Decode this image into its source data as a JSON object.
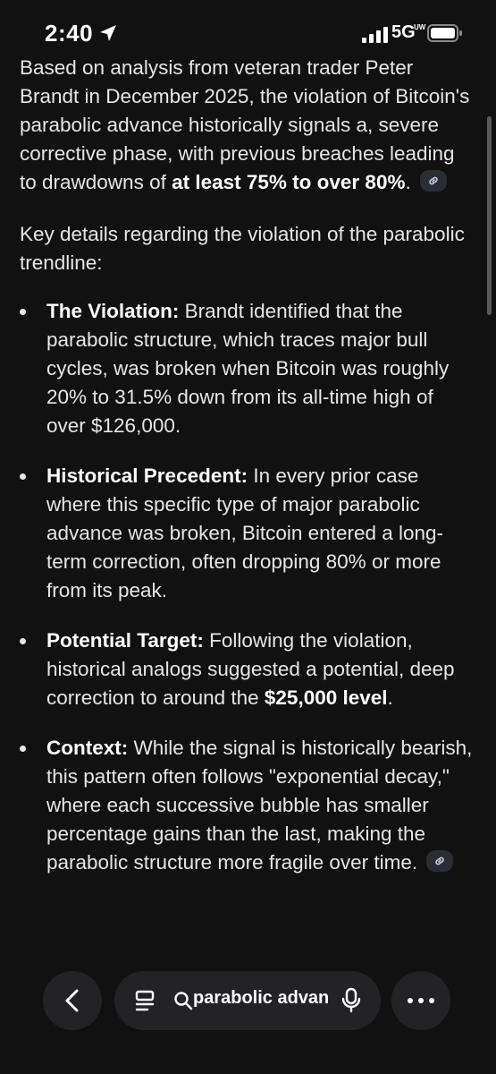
{
  "status": {
    "time": "2:40",
    "network": "5G",
    "network_sub": "UW"
  },
  "article": {
    "intro_text": "Based on analysis from veteran trader Peter Brandt in December 2025, the violation of Bitcoin's parabolic advance historically signals a, severe corrective phase, with previous breaches leading to drawdowns of ",
    "intro_bold": "at least 75% to over 80%",
    "intro_end": ".",
    "key_details": "Key details regarding the violation of the parabolic trendline:",
    "bullets": [
      {
        "title": "The Violation:",
        "text": " Brandt identified that the parabolic structure, which traces major bull cycles, was broken when Bitcoin was roughly 20% to 31.5% down from its all-time high of over $126,000."
      },
      {
        "title": "Historical Precedent:",
        "text": " In every prior case where this specific type of major parabolic advance was broken, Bitcoin entered a long-term correction, often dropping 80% or more from its peak."
      },
      {
        "title": "Potential Target:",
        "text": " Following the violation, historical analogs suggested a potential, deep correction to around the ",
        "bold": "$25,000 level",
        "end": "."
      },
      {
        "title": "Context:",
        "text": " While the signal is historically bearish, this pattern often follows \"exponential decay,\" where each successive bubble has smaller percentage gains than the last, making the parabolic structure more fragile over time."
      }
    ]
  },
  "toolbar": {
    "search_text": "parabolic advan",
    "icons": [
      "back-icon",
      "list-icon",
      "search-icon",
      "mic-icon",
      "more-icon"
    ]
  },
  "colors": {
    "background": "#111112",
    "text": "#e6e6e8",
    "chip": "#2b2d36",
    "control": "#232326"
  }
}
